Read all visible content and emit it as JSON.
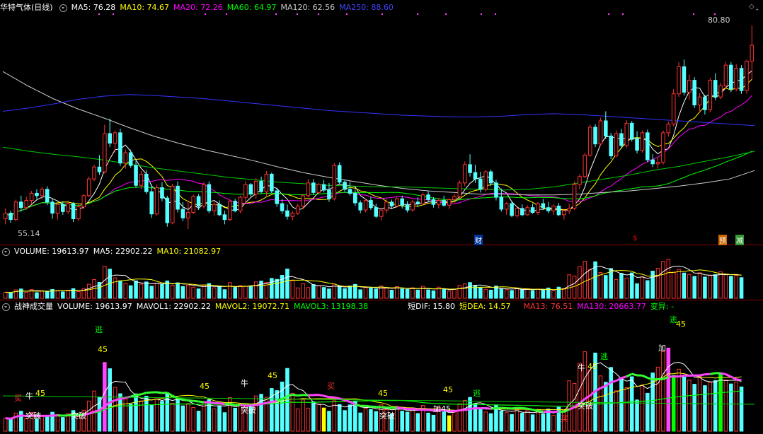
{
  "price_header": {
    "stock_name": "华特气体",
    "period": "(日线)",
    "ma": [
      {
        "label": "MA5: 76.28",
        "color": "#ffffff"
      },
      {
        "label": "MA10: 74.67",
        "color": "#ffff00"
      },
      {
        "label": "MA20: 72.26",
        "color": "#ff00ff"
      },
      {
        "label": "MA60: 64.97",
        "color": "#00ff00"
      },
      {
        "label": "MA120: 62.56",
        "color": "#cccccc"
      },
      {
        "label": "MA250: 88.60",
        "color": "#3333ff"
      }
    ]
  },
  "volume_header": {
    "name": "VOLUME: 19613.97",
    "ma5": "MA5: 22902.22",
    "ma10": "MA10: 21082.97"
  },
  "indicator_header": {
    "name": "战神成交量",
    "volume": "VOLUME: 19613.97",
    "mavol1": "MAVOL1: 22902.22",
    "mavol2": "MAVOL2: 19072.71",
    "mavol3": "MAVOL3: 13198.38",
    "dif": "短DIF: 15.80",
    "dea": "短DEA: 14.57",
    "ma13": "MA13: 76.51",
    "ma130": "MA130: 20663.77",
    "change": "变异: -"
  },
  "price_labels": {
    "high": "80.80",
    "low": "55.14"
  },
  "event_tags": [
    {
      "text": "财",
      "color": "#ffffff",
      "bg": "#003399"
    },
    {
      "text": "$",
      "color": "#ff0000",
      "bg": ""
    },
    {
      "text": "预",
      "color": "#ffffff",
      "bg": "#cc6600"
    },
    {
      "text": "减",
      "color": "#ffffff",
      "bg": "#339933"
    }
  ],
  "signal_labels": [
    {
      "text": "买",
      "color": "#ff3333"
    },
    {
      "text": "牛",
      "color": "#ffffff"
    },
    {
      "text": "45",
      "color": "#ffff00"
    },
    {
      "text": "突破",
      "color": "#ffffff"
    },
    {
      "text": "突破",
      "color": "#ffffff"
    },
    {
      "text": "45",
      "color": "#ffff00"
    },
    {
      "text": "45",
      "color": "#ffff00"
    },
    {
      "text": "逃",
      "color": "#00ff00"
    },
    {
      "text": "45",
      "color": "#ffff00"
    },
    {
      "text": "牛",
      "color": "#ffffff"
    },
    {
      "text": "45",
      "color": "#ffff00"
    },
    {
      "text": "突破",
      "color": "#ffffff"
    },
    {
      "text": "买",
      "color": "#ff3333"
    },
    {
      "text": "45",
      "color": "#ffff00"
    },
    {
      "text": "突破",
      "color": "#ffffff"
    },
    {
      "text": "加45",
      "color": "#ffffff"
    },
    {
      "text": "逃",
      "color": "#00ff00"
    },
    {
      "text": "买",
      "color": "#ff3333"
    },
    {
      "text": "突破",
      "color": "#ffffff"
    },
    {
      "text": "牛",
      "color": "#ffffff"
    },
    {
      "text": "45",
      "color": "#ffff00"
    },
    {
      "text": "逃",
      "color": "#00ff00"
    },
    {
      "text": "加",
      "color": "#ffffff"
    },
    {
      "text": "逃",
      "color": "#00ff00"
    },
    {
      "text": "45",
      "color": "#ffff00"
    }
  ],
  "chart_data": {
    "type": "candlestick",
    "y_range": [
      55.14,
      80.8
    ],
    "candles": [
      [
        56.5,
        57.8,
        55.8,
        57.2
      ],
      [
        57.2,
        57.5,
        56.0,
        56.4
      ],
      [
        56.4,
        58.9,
        56.2,
        58.6
      ],
      [
        58.6,
        59.4,
        57.4,
        57.9
      ],
      [
        57.9,
        59.3,
        57.6,
        58.8
      ],
      [
        58.8,
        60.0,
        58.3,
        59.7
      ],
      [
        59.7,
        60.2,
        59.0,
        59.4
      ],
      [
        59.4,
        60.5,
        58.9,
        60.2
      ],
      [
        60.2,
        60.6,
        58.2,
        58.6
      ],
      [
        58.6,
        59.0,
        56.5,
        57.2
      ],
      [
        57.2,
        58.5,
        56.4,
        58.3
      ],
      [
        58.3,
        58.7,
        57.0,
        57.4
      ],
      [
        57.4,
        58.8,
        57.1,
        58.4
      ],
      [
        58.4,
        58.6,
        56.1,
        56.5
      ],
      [
        56.5,
        58.3,
        56.2,
        58.0
      ],
      [
        58.0,
        59.6,
        57.7,
        59.4
      ],
      [
        59.4,
        61.8,
        59.2,
        61.5
      ],
      [
        61.5,
        63.3,
        61.2,
        63.0
      ],
      [
        63.0,
        64.5,
        62.0,
        62.4
      ],
      [
        62.4,
        68.3,
        62.2,
        67.2
      ],
      [
        67.2,
        69.1,
        65.5,
        66.0
      ],
      [
        66.0,
        67.6,
        64.8,
        67.3
      ],
      [
        67.3,
        67.8,
        63.1,
        63.5
      ],
      [
        63.5,
        65.2,
        62.8,
        64.8
      ],
      [
        64.8,
        65.2,
        62.9,
        63.2
      ],
      [
        63.2,
        63.8,
        60.4,
        60.7
      ],
      [
        60.7,
        62.5,
        60.2,
        62.1
      ],
      [
        62.1,
        62.6,
        59.6,
        59.9
      ],
      [
        59.9,
        60.8,
        56.6,
        57.1
      ],
      [
        57.1,
        60.8,
        56.9,
        60.4
      ],
      [
        60.4,
        61.1,
        58.7,
        59.1
      ],
      [
        59.1,
        59.4,
        55.5,
        56.0
      ],
      [
        56.0,
        60.9,
        55.8,
        60.6
      ],
      [
        60.6,
        61.2,
        57.3,
        57.7
      ],
      [
        57.7,
        58.6,
        56.2,
        56.6
      ],
      [
        56.6,
        58.6,
        55.2,
        57.3
      ],
      [
        57.3,
        59.5,
        57.1,
        59.3
      ],
      [
        59.3,
        59.6,
        57.6,
        58.1
      ],
      [
        58.1,
        61.1,
        57.8,
        60.8
      ],
      [
        60.8,
        61.2,
        57.2,
        57.5
      ],
      [
        57.5,
        58.6,
        56.9,
        58.3
      ],
      [
        58.3,
        58.8,
        56.8,
        57.0
      ],
      [
        57.0,
        57.5,
        55.8,
        56.4
      ],
      [
        56.4,
        58.9,
        56.2,
        58.7
      ],
      [
        58.7,
        59.0,
        57.3,
        57.5
      ],
      [
        57.5,
        59.4,
        57.2,
        59.2
      ],
      [
        59.2,
        61.2,
        58.5,
        60.8
      ],
      [
        60.8,
        61.0,
        59.3,
        59.6
      ],
      [
        59.6,
        61.6,
        59.0,
        61.2
      ],
      [
        61.2,
        61.8,
        59.7,
        59.9
      ],
      [
        59.9,
        62.5,
        59.4,
        62.1
      ],
      [
        62.1,
        62.3,
        59.7,
        60.0
      ],
      [
        60.0,
        60.4,
        58.0,
        58.4
      ],
      [
        58.4,
        59.0,
        57.1,
        57.5
      ],
      [
        57.5,
        58.3,
        56.4,
        56.8
      ],
      [
        56.8,
        57.5,
        56.3,
        57.2
      ],
      [
        57.2,
        58.4,
        57.0,
        58.1
      ],
      [
        58.1,
        59.6,
        57.7,
        59.4
      ],
      [
        59.4,
        61.5,
        59.2,
        61.0
      ],
      [
        61.0,
        61.5,
        59.5,
        59.8
      ],
      [
        59.8,
        61.0,
        59.6,
        60.8
      ],
      [
        60.8,
        61.4,
        59.8,
        60.1
      ],
      [
        60.1,
        61.0,
        58.6,
        59.0
      ],
      [
        59.0,
        63.5,
        58.8,
        63.2
      ],
      [
        63.2,
        63.6,
        60.8,
        61.1
      ],
      [
        61.1,
        61.4,
        59.9,
        60.2
      ],
      [
        60.2,
        61.2,
        59.4,
        59.7
      ],
      [
        59.7,
        60.2,
        58.1,
        58.5
      ],
      [
        58.5,
        58.8,
        57.2,
        57.6
      ],
      [
        57.6,
        59.0,
        57.3,
        58.8
      ],
      [
        58.8,
        59.3,
        57.6,
        57.9
      ],
      [
        57.9,
        58.4,
        56.6,
        56.8
      ],
      [
        56.8,
        57.8,
        56.3,
        57.6
      ],
      [
        57.6,
        59.0,
        57.2,
        58.6
      ],
      [
        58.6,
        58.9,
        57.7,
        58.1
      ],
      [
        58.1,
        59.3,
        57.9,
        59.0
      ],
      [
        59.0,
        59.4,
        57.8,
        58.2
      ],
      [
        58.2,
        58.7,
        57.3,
        57.6
      ],
      [
        57.6,
        58.9,
        57.4,
        58.6
      ],
      [
        58.6,
        59.2,
        58.0,
        58.4
      ],
      [
        58.4,
        59.8,
        58.2,
        59.5
      ],
      [
        59.5,
        60.0,
        58.6,
        58.9
      ],
      [
        58.9,
        59.2,
        57.9,
        58.3
      ],
      [
        58.3,
        59.1,
        57.8,
        58.8
      ],
      [
        58.8,
        59.4,
        58.0,
        58.2
      ],
      [
        58.2,
        59.1,
        57.7,
        58.9
      ],
      [
        58.9,
        59.6,
        58.5,
        59.3
      ],
      [
        59.3,
        61.3,
        59.1,
        61.0
      ],
      [
        61.0,
        63.7,
        60.6,
        63.3
      ],
      [
        63.3,
        64.6,
        61.8,
        62.3
      ],
      [
        62.3,
        63.3,
        61.0,
        61.5
      ],
      [
        61.5,
        62.4,
        59.8,
        60.2
      ],
      [
        60.2,
        62.6,
        59.9,
        62.4
      ],
      [
        62.4,
        62.7,
        60.6,
        61.0
      ],
      [
        61.0,
        61.4,
        58.8,
        59.2
      ],
      [
        59.2,
        60.3,
        57.4,
        57.7
      ],
      [
        57.7,
        58.6,
        57.0,
        58.4
      ],
      [
        58.4,
        58.7,
        56.7,
        56.9
      ],
      [
        56.9,
        58.0,
        56.6,
        57.8
      ],
      [
        57.8,
        58.3,
        56.8,
        57.0
      ],
      [
        57.0,
        58.2,
        56.9,
        57.9
      ],
      [
        57.9,
        58.4,
        57.1,
        57.3
      ],
      [
        57.3,
        58.6,
        57.0,
        58.4
      ],
      [
        58.4,
        59.0,
        57.6,
        57.9
      ],
      [
        57.9,
        58.6,
        57.2,
        57.5
      ],
      [
        57.5,
        58.3,
        57.0,
        58.1
      ],
      [
        58.1,
        58.5,
        56.8,
        57.0
      ],
      [
        57.0,
        57.8,
        56.4,
        57.5
      ],
      [
        57.5,
        58.4,
        57.1,
        57.8
      ],
      [
        57.8,
        61.2,
        57.6,
        60.8
      ],
      [
        60.8,
        62.1,
        60.2,
        61.8
      ],
      [
        61.8,
        64.8,
        61.6,
        64.5
      ],
      [
        64.5,
        68.3,
        64.3,
        68.0
      ],
      [
        68.0,
        68.4,
        65.5,
        65.9
      ],
      [
        65.9,
        69.2,
        65.7,
        68.8
      ],
      [
        68.8,
        70.0,
        66.5,
        66.9
      ],
      [
        66.9,
        67.3,
        64.0,
        64.4
      ],
      [
        64.4,
        67.6,
        64.2,
        67.2
      ],
      [
        67.2,
        67.8,
        65.3,
        65.7
      ],
      [
        65.7,
        68.9,
        65.4,
        68.5
      ],
      [
        68.5,
        68.8,
        66.2,
        66.5
      ],
      [
        66.5,
        67.5,
        64.7,
        65.1
      ],
      [
        65.1,
        67.6,
        64.8,
        67.3
      ],
      [
        67.3,
        67.7,
        63.6,
        63.9
      ],
      [
        63.9,
        64.6,
        63.0,
        63.4
      ],
      [
        63.4,
        64.2,
        62.8,
        63.6
      ],
      [
        63.6,
        67.6,
        63.3,
        67.3
      ],
      [
        67.3,
        68.7,
        66.8,
        68.4
      ],
      [
        68.4,
        72.8,
        68.1,
        72.2
      ],
      [
        72.2,
        76.2,
        71.8,
        75.6
      ],
      [
        75.6,
        76.5,
        72.0,
        72.4
      ],
      [
        72.4,
        74.6,
        71.4,
        73.9
      ],
      [
        73.9,
        74.3,
        70.4,
        70.8
      ],
      [
        70.8,
        72.3,
        69.8,
        71.8
      ],
      [
        71.8,
        72.1,
        69.6,
        70.2
      ],
      [
        70.2,
        74.2,
        69.9,
        73.9
      ],
      [
        73.9,
        74.8,
        71.4,
        71.8
      ],
      [
        71.8,
        73.6,
        71.5,
        73.2
      ],
      [
        73.2,
        76.2,
        72.8,
        75.8
      ],
      [
        75.8,
        76.2,
        72.4,
        72.8
      ],
      [
        72.8,
        75.9,
        72.5,
        75.4
      ],
      [
        75.4,
        75.8,
        72.2,
        72.6
      ],
      [
        72.6,
        76.5,
        72.2,
        76.3
      ],
      [
        76.3,
        80.8,
        74.0,
        78.3
      ]
    ],
    "ma_series": [
      {
        "name": "MA5",
        "color": "#ffffff",
        "period": 5
      },
      {
        "name": "MA10",
        "color": "#ffff00",
        "period": 10
      },
      {
        "name": "MA20",
        "color": "#ff00ff",
        "period": 20
      },
      {
        "name": "MA60",
        "color": "#00ff00",
        "period": 60
      },
      {
        "name": "MA120",
        "color": "#cccccc",
        "period": 120
      },
      {
        "name": "MA250",
        "color": "#3333ff",
        "period": 250
      }
    ],
    "volume_range": [
      0,
      60000
    ],
    "volume": [
      9200,
      8400,
      12800,
      14100,
      9100,
      13200,
      8500,
      11200,
      10600,
      13400,
      11800,
      9700,
      12300,
      14600,
      10200,
      14800,
      21300,
      28400,
      24100,
      48600,
      44200,
      31000,
      26500,
      22800,
      19100,
      26400,
      21400,
      24800,
      18300,
      22900,
      21100,
      26300,
      19800,
      23400,
      17900,
      19600,
      16800,
      14200,
      20100,
      22400,
      15800,
      17500,
      13100,
      23800,
      16300,
      19200,
      18400,
      17900,
      24900,
      26100,
      24000,
      30200,
      28700,
      34800,
      44400,
      26800,
      15700,
      22100,
      16300,
      20800,
      19200,
      16400,
      14100,
      21500,
      18900,
      14600,
      18600,
      21100,
      12900,
      16200,
      15400,
      13900,
      18600,
      15300,
      12300,
      17700,
      14200,
      13400,
      15900,
      12500,
      18200,
      12800,
      11300,
      16800,
      13600,
      10900,
      14100,
      19400,
      21800,
      23900,
      19600,
      15800,
      13600,
      12400,
      18600,
      14200,
      13100,
      11800,
      15200,
      12700,
      14500,
      11600,
      13800,
      12200,
      15600,
      11300,
      16900,
      14800,
      35600,
      33800,
      48100,
      56200,
      43200,
      55300,
      39100,
      34600,
      45100,
      28600,
      37800,
      30800,
      38500,
      22100,
      32600,
      26800,
      41200,
      45300,
      56200,
      58800,
      39600,
      43800,
      38300,
      36100,
      33200,
      38700,
      32200,
      34500,
      35800,
      40100,
      36200,
      33400,
      34800,
      31300
    ]
  }
}
